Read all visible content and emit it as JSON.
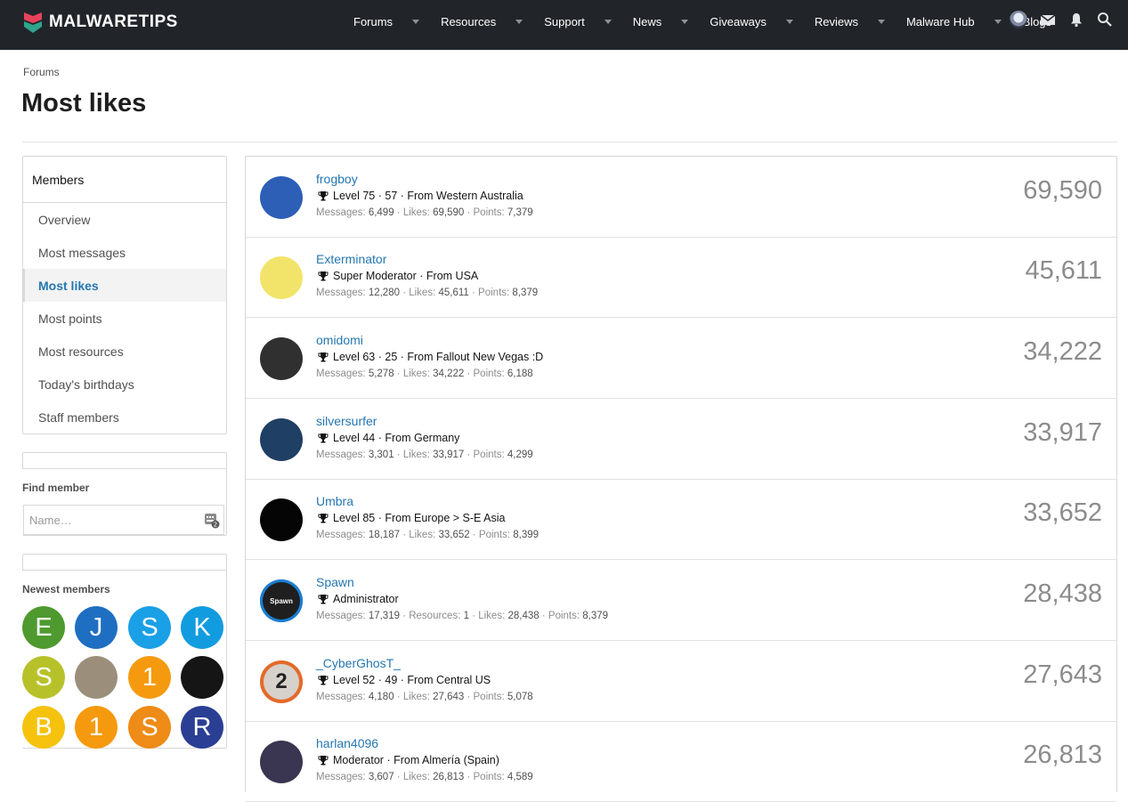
{
  "header": {
    "logo_text": "MALWARETIPS",
    "nav": [
      {
        "label": "Forums",
        "caret": true
      },
      {
        "label": "Resources",
        "caret": true
      },
      {
        "label": "Support",
        "caret": true
      },
      {
        "label": "News",
        "caret": true
      },
      {
        "label": "Giveaways",
        "caret": true
      },
      {
        "label": "Reviews",
        "caret": true
      },
      {
        "label": "Malware Hub",
        "caret": true
      },
      {
        "label": "Blogs",
        "caret": false
      }
    ],
    "icons": [
      "user-avatar",
      "mail-icon",
      "bell-icon",
      "search-icon"
    ]
  },
  "breadcrumb": "Forums",
  "page_title": "Most likes",
  "sidebar": {
    "members_heading": "Members",
    "links": [
      {
        "label": "Overview",
        "active": false
      },
      {
        "label": "Most messages",
        "active": false
      },
      {
        "label": "Most likes",
        "active": true
      },
      {
        "label": "Most points",
        "active": false
      },
      {
        "label": "Most resources",
        "active": false
      },
      {
        "label": "Today's birthdays",
        "active": false
      },
      {
        "label": "Staff members",
        "active": false
      }
    ],
    "find_member_label": "Find member",
    "find_member_placeholder": "Name…",
    "newest_members_label": "Newest members",
    "newest_members": [
      {
        "letter": "E",
        "color": "#4e9a2f"
      },
      {
        "letter": "J",
        "color": "#1e6fc2"
      },
      {
        "letter": "S",
        "color": "#1aa0e6"
      },
      {
        "letter": "K",
        "color": "#129ce0"
      },
      {
        "letter": "S",
        "color": "#b7c22a"
      },
      {
        "letter": "",
        "color": "#9b8f7c"
      },
      {
        "letter": "1",
        "color": "#f59a0e"
      },
      {
        "letter": "",
        "color": "#151515"
      },
      {
        "letter": "B",
        "color": "#f5c20e"
      },
      {
        "letter": "1",
        "color": "#f59a0e"
      },
      {
        "letter": "S",
        "color": "#ef8b17"
      },
      {
        "letter": "R",
        "color": "#2a3f94"
      }
    ]
  },
  "members": [
    {
      "name": "frogboy",
      "title": "Level 75 · 57 · From Western Australia",
      "stats": [
        [
          "Messages:",
          "6,499"
        ],
        [
          "Likes:",
          "69,590"
        ],
        [
          "Points:",
          "7,379"
        ]
      ],
      "count": "69,590",
      "avatar_color": "#2d5fb7"
    },
    {
      "name": "Exterminator",
      "title": "Super Moderator · From USA",
      "stats": [
        [
          "Messages:",
          "12,280"
        ],
        [
          "Likes:",
          "45,611"
        ],
        [
          "Points:",
          "8,379"
        ]
      ],
      "count": "45,611",
      "avatar_color": "#f2e46a"
    },
    {
      "name": "omidomi",
      "title": "Level 63 · 25 · From Fallout New Vegas :D",
      "stats": [
        [
          "Messages:",
          "5,278"
        ],
        [
          "Likes:",
          "34,222"
        ],
        [
          "Points:",
          "6,188"
        ]
      ],
      "count": "34,222",
      "avatar_color": "#303030"
    },
    {
      "name": "silversurfer",
      "title": "Level 44 · From Germany",
      "stats": [
        [
          "Messages:",
          "3,301"
        ],
        [
          "Likes:",
          "33,917"
        ],
        [
          "Points:",
          "4,299"
        ]
      ],
      "count": "33,917",
      "avatar_color": "#1f3f64"
    },
    {
      "name": "Umbra",
      "title": "Level 85 · From Europe > S-E Asia",
      "stats": [
        [
          "Messages:",
          "18,187"
        ],
        [
          "Likes:",
          "33,652"
        ],
        [
          "Points:",
          "8,399"
        ]
      ],
      "count": "33,652",
      "avatar_color": "#050505"
    },
    {
      "name": "Spawn",
      "title": "Administrator",
      "stats": [
        [
          "Messages:",
          "17,319"
        ],
        [
          "Resources:",
          "1"
        ],
        [
          "Likes:",
          "28,438"
        ],
        [
          "Points:",
          "8,379"
        ]
      ],
      "count": "28,438",
      "avatar_color": "#1f1f1f",
      "avatar_text": "Spawn"
    },
    {
      "name": "_CyberGhosT_",
      "title": "Level 52 · 49 · From Central US",
      "stats": [
        [
          "Messages:",
          "4,180"
        ],
        [
          "Likes:",
          "27,643"
        ],
        [
          "Points:",
          "5,078"
        ]
      ],
      "count": "27,643",
      "avatar_color": "#d6d1cb",
      "avatar_text": "2"
    },
    {
      "name": "harlan4096",
      "title": "Moderator · From Almería (Spain)",
      "stats": [
        [
          "Messages:",
          "3,607"
        ],
        [
          "Likes:",
          "26,813"
        ],
        [
          "Points:",
          "4,589"
        ]
      ],
      "count": "26,813",
      "avatar_color": "#3a3550"
    }
  ]
}
